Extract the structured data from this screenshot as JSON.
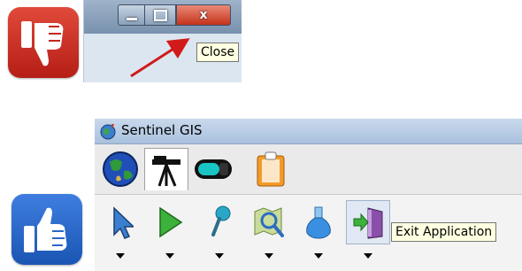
{
  "top_window": {
    "caption_buttons": {
      "minimize_icon": "minimize-icon",
      "maximize_icon": "maximize-icon",
      "close_glyph": "x"
    },
    "tooltip": "Close"
  },
  "sentinel_window": {
    "title": "Sentinel GIS",
    "app_icon": "globe-pin-icon",
    "tabs": [
      {
        "icon": "globe-icon"
      },
      {
        "icon": "sensor-tripod-icon"
      },
      {
        "icon": "battery-icon"
      },
      {
        "icon": "clipboard-icon"
      }
    ],
    "tools": [
      {
        "icon": "cursor-arrow-icon"
      },
      {
        "icon": "play-icon"
      },
      {
        "icon": "pin-icon"
      },
      {
        "icon": "map-zoom-icon"
      },
      {
        "icon": "flask-icon"
      },
      {
        "icon": "exit-door-icon"
      }
    ],
    "tooltip": "Exit Application"
  },
  "colors": {
    "thumbs_down_badge": "#c4261b",
    "thumbs_up_badge": "#2a66c9",
    "arrow": "#d11a1a",
    "tooltip_bg": "#ffffe1"
  }
}
